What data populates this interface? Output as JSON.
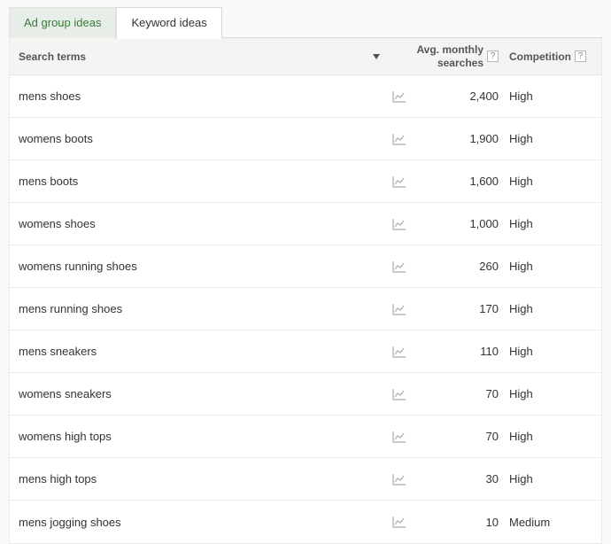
{
  "tabs": {
    "ad_group": "Ad group ideas",
    "keyword": "Keyword ideas"
  },
  "columns": {
    "search_terms": "Search terms",
    "avg_monthly": "Avg. monthly\nsearches",
    "competition": "Competition"
  },
  "help_glyph": "?",
  "rows": [
    {
      "term": "mens shoes",
      "avg": "2,400",
      "comp": "High"
    },
    {
      "term": "womens boots",
      "avg": "1,900",
      "comp": "High"
    },
    {
      "term": "mens boots",
      "avg": "1,600",
      "comp": "High"
    },
    {
      "term": "womens shoes",
      "avg": "1,000",
      "comp": "High"
    },
    {
      "term": "womens running shoes",
      "avg": "260",
      "comp": "High"
    },
    {
      "term": "mens running shoes",
      "avg": "170",
      "comp": "High"
    },
    {
      "term": "mens sneakers",
      "avg": "110",
      "comp": "High"
    },
    {
      "term": "womens sneakers",
      "avg": "70",
      "comp": "High"
    },
    {
      "term": "womens high tops",
      "avg": "70",
      "comp": "High"
    },
    {
      "term": "mens high tops",
      "avg": "30",
      "comp": "High"
    },
    {
      "term": "mens jogging shoes",
      "avg": "10",
      "comp": "Medium"
    }
  ]
}
